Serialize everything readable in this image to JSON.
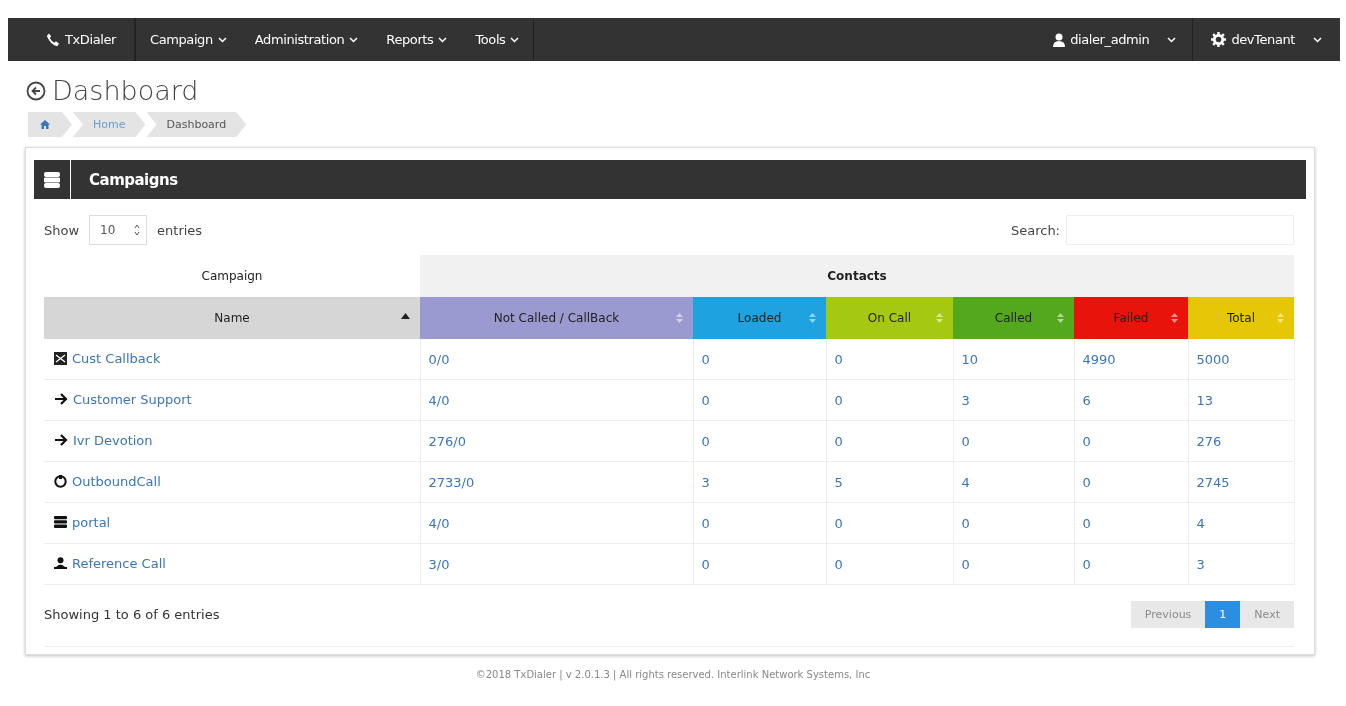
{
  "navbar": {
    "brand": "TxDialer",
    "menus": [
      {
        "label": "Campaign"
      },
      {
        "label": "Administration"
      },
      {
        "label": "Reports"
      },
      {
        "label": "Tools"
      }
    ],
    "user": "dialer_admin",
    "tenant": "devTenant"
  },
  "page": {
    "title": "Dashboard",
    "breadcrumb": [
      {
        "kind": "home"
      },
      {
        "kind": "link",
        "label": "Home"
      },
      {
        "kind": "current",
        "label": "Dashboard"
      }
    ]
  },
  "panel": {
    "title": "Campaigns",
    "length": {
      "before": "Show",
      "value": "10",
      "after": "entries"
    },
    "search": {
      "label": "Search:"
    },
    "table": {
      "groups": [
        {
          "label": "Campaign"
        },
        {
          "label": "Contacts"
        }
      ],
      "columns": [
        {
          "label": "Name",
          "color": "#d6d6d6",
          "sorted": true
        },
        {
          "label": "Not Called / CallBack",
          "color": "#9b9ad0",
          "sorted": false
        },
        {
          "label": "Loaded",
          "color": "#1ea3e0",
          "sorted": false
        },
        {
          "label": "On Call",
          "color": "#a5c911",
          "sorted": false
        },
        {
          "label": "Called",
          "color": "#54a81e",
          "sorted": false
        },
        {
          "label": "Failed",
          "color": "#e8140c",
          "sorted": false
        },
        {
          "label": "Total",
          "color": "#e5c708",
          "sorted": false
        }
      ],
      "rows": [
        {
          "kind": "mail",
          "cells": [
            "Cust Callback",
            "0/0",
            "0",
            "0",
            "10",
            "4990",
            "5000"
          ]
        },
        {
          "kind": "arrow",
          "cells": [
            "Customer Support",
            "4/0",
            "0",
            "0",
            "3",
            "6",
            "13"
          ]
        },
        {
          "kind": "arrow",
          "cells": [
            "Ivr Devotion",
            "276/0",
            "0",
            "0",
            "0",
            "0",
            "276"
          ]
        },
        {
          "kind": "cycle",
          "cells": [
            "OutboundCall",
            "2733/0",
            "3",
            "5",
            "4",
            "0",
            "2745"
          ]
        },
        {
          "kind": "stack",
          "cells": [
            "portal",
            "4/0",
            "0",
            "0",
            "0",
            "0",
            "4"
          ]
        },
        {
          "kind": "user",
          "cells": [
            "Reference Call",
            "3/0",
            "0",
            "0",
            "0",
            "0",
            "3"
          ]
        }
      ]
    },
    "info": "Showing 1 to 6 of 6 entries",
    "pagination": [
      {
        "label": "Previous",
        "disabled": true,
        "selected": false
      },
      {
        "label": "1",
        "disabled": false,
        "selected": true
      },
      {
        "label": "Next",
        "disabled": true,
        "selected": false
      }
    ]
  },
  "footer": "©2018 TxDialer | v 2.0.1.3 | All rights reserved. Interlink Network Systems, Inc"
}
